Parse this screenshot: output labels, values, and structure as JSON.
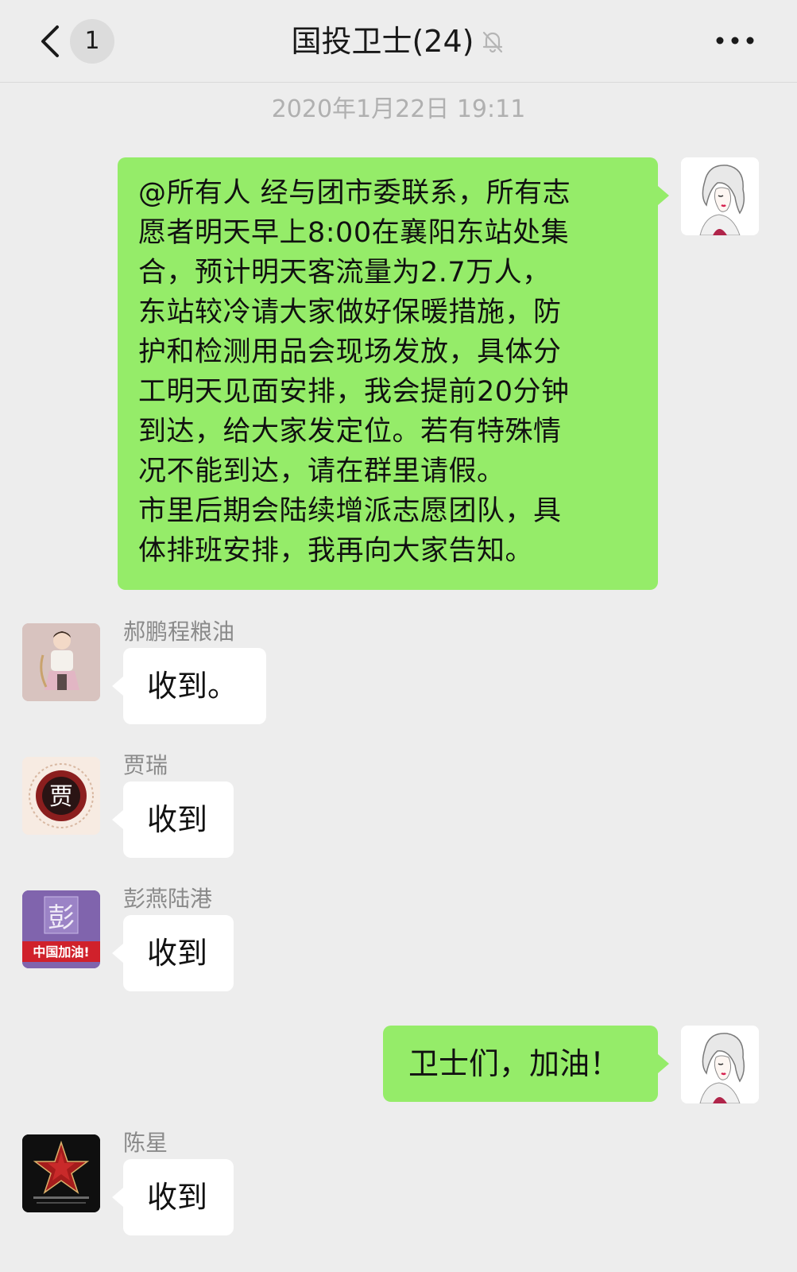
{
  "header": {
    "unread_count": "1",
    "title": "国投卫士(24)"
  },
  "chat": {
    "timestamp": "2020年1月22日 19:11",
    "messages": [
      {
        "sender": "",
        "text": "@所有人 经与团市委联系，所有志\n愿者明天早上8:00在襄阳东站处集\n合，预计明天客流量为2.7万人，\n东站较冷请大家做好保暖措施，防\n护和检测用品会现场发放，具体分\n工明天见面安排，我会提前20分钟\n到达，给大家发定位。若有特殊情\n况不能到达，请在群里请假。\n市里后期会陆续增派志愿团队，具\n体排班安排，我再向大家告知。"
      },
      {
        "sender": "郝鹏程粮油",
        "text": "收到。"
      },
      {
        "sender": "贾瑞",
        "text": "收到",
        "avatar_text": "贾"
      },
      {
        "sender": "彭燕陆港",
        "text": "收到",
        "avatar_text": "彭",
        "avatar_banner": "中国加油!"
      },
      {
        "sender": "",
        "text": "卫士们，加油！"
      },
      {
        "sender": "陈星",
        "text": "收到"
      }
    ]
  },
  "colors": {
    "background": "#ededed",
    "mine_bubble": "#95ec69",
    "theirs_bubble": "#ffffff",
    "name_gray": "#8a8a8a",
    "time_gray": "#b0b0b0"
  },
  "icons": {
    "back": "chevron-left-icon",
    "mute": "bell-off-icon",
    "more": "more-horizontal-icon"
  }
}
